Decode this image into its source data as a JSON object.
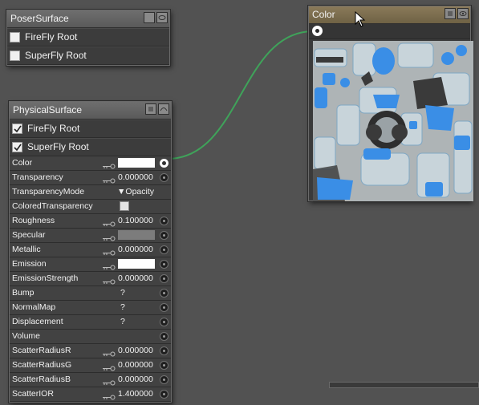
{
  "poser_surface": {
    "title": "PoserSurface",
    "roots": [
      {
        "label": "FireFly Root",
        "checked": false
      },
      {
        "label": "SuperFly Root",
        "checked": false
      }
    ]
  },
  "physical_surface": {
    "title": "PhysicalSurface",
    "roots": [
      {
        "label": "FireFly Root",
        "checked": true
      },
      {
        "label": "SuperFly Root",
        "checked": true
      }
    ],
    "params": [
      {
        "label": "Color",
        "kind": "swatch",
        "swatch_color": "#ffffff",
        "connected": true
      },
      {
        "label": "Transparency",
        "kind": "number",
        "value": "0.000000"
      },
      {
        "label": "TransparencyMode",
        "kind": "dropdown",
        "value": "Opacity"
      },
      {
        "label": "ColoredTransparency",
        "kind": "checkbox"
      },
      {
        "label": "Roughness",
        "kind": "number",
        "value": "0.100000"
      },
      {
        "label": "Specular",
        "kind": "swatch",
        "swatch_color": "#7c7c7c"
      },
      {
        "label": "Metallic",
        "kind": "number",
        "value": "0.000000"
      },
      {
        "label": "Emission",
        "kind": "swatch",
        "swatch_color": "#ffffff"
      },
      {
        "label": "EmissionStrength",
        "kind": "number",
        "value": "0.000000"
      },
      {
        "label": "Bump",
        "kind": "question",
        "value": "?"
      },
      {
        "label": "NormalMap",
        "kind": "question",
        "value": "?"
      },
      {
        "label": "Displacement",
        "kind": "question",
        "value": "?"
      },
      {
        "label": "Volume",
        "kind": "empty"
      },
      {
        "label": "ScatterRadiusR",
        "kind": "number",
        "value": "0.000000"
      },
      {
        "label": "ScatterRadiusG",
        "kind": "number",
        "value": "0.000000"
      },
      {
        "label": "ScatterRadiusB",
        "kind": "number",
        "value": "0.000000"
      },
      {
        "label": "ScatterIOR",
        "kind": "number",
        "value": "1.400000"
      }
    ]
  },
  "color_node": {
    "title": "Color",
    "texture_colors": {
      "base": "#aeb4b6",
      "blue": "#3a8ee6",
      "light": "#c8d4da",
      "dark": "#3a3a3a"
    }
  },
  "colors": {
    "canvas_bg": "#525252",
    "node_bg": "#3a3a3a",
    "connection_line": "#3fa35a"
  },
  "icons": {
    "header_buttons": [
      "options-icon",
      "preview-toggle-icon"
    ],
    "key_icon": "key-icon",
    "cursor": "mouse-pointer-icon"
  }
}
